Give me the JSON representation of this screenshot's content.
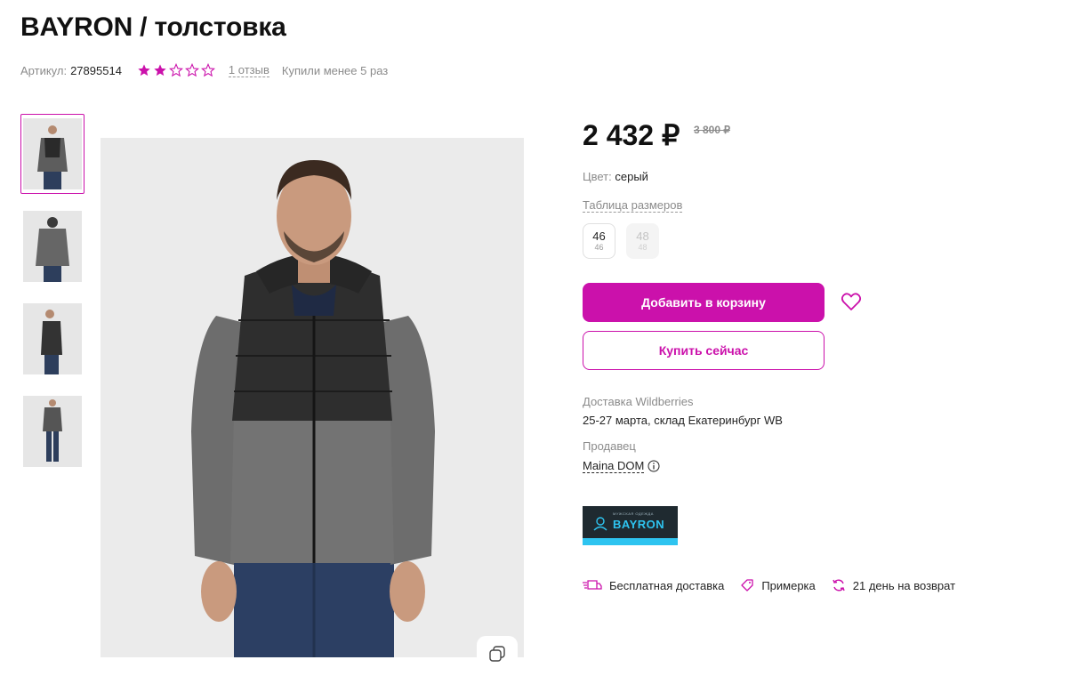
{
  "product": {
    "title": "BAYRON / толстовка",
    "sku_label": "Артикул:",
    "sku_value": "27895514",
    "rating": 2,
    "rating_max": 5,
    "reviews_link": "1 отзыв",
    "bought_text": "Купили менее 5 раз"
  },
  "pricing": {
    "price": "2 432 ₽",
    "old_price": "3 800 ₽"
  },
  "color": {
    "label": "Цвет:",
    "value": "серый"
  },
  "sizes": {
    "table_link": "Таблица размеров",
    "items": [
      {
        "size": "46",
        "ru": "46",
        "available": true
      },
      {
        "size": "48",
        "ru": "48",
        "available": false
      }
    ]
  },
  "actions": {
    "add_to_cart": "Добавить в корзину",
    "buy_now": "Купить сейчас"
  },
  "delivery": {
    "label": "Доставка Wildberries",
    "value": "25-27 марта, склад Екатеринбург WB"
  },
  "seller": {
    "label": "Продавец",
    "value": "Maina DOM"
  },
  "brand_logo": {
    "small_text": "МУЖСКАЯ ОДЕЖДА",
    "name": "BAYRON"
  },
  "features": [
    {
      "icon": "truck-icon",
      "label": "Бесплатная доставка"
    },
    {
      "icon": "tag-icon",
      "label": "Примерка"
    },
    {
      "icon": "refresh-icon",
      "label": "21 день на возврат"
    }
  ],
  "colors": {
    "accent": "#cb11ab",
    "text": "#242424",
    "muted": "#8b8b8b"
  }
}
